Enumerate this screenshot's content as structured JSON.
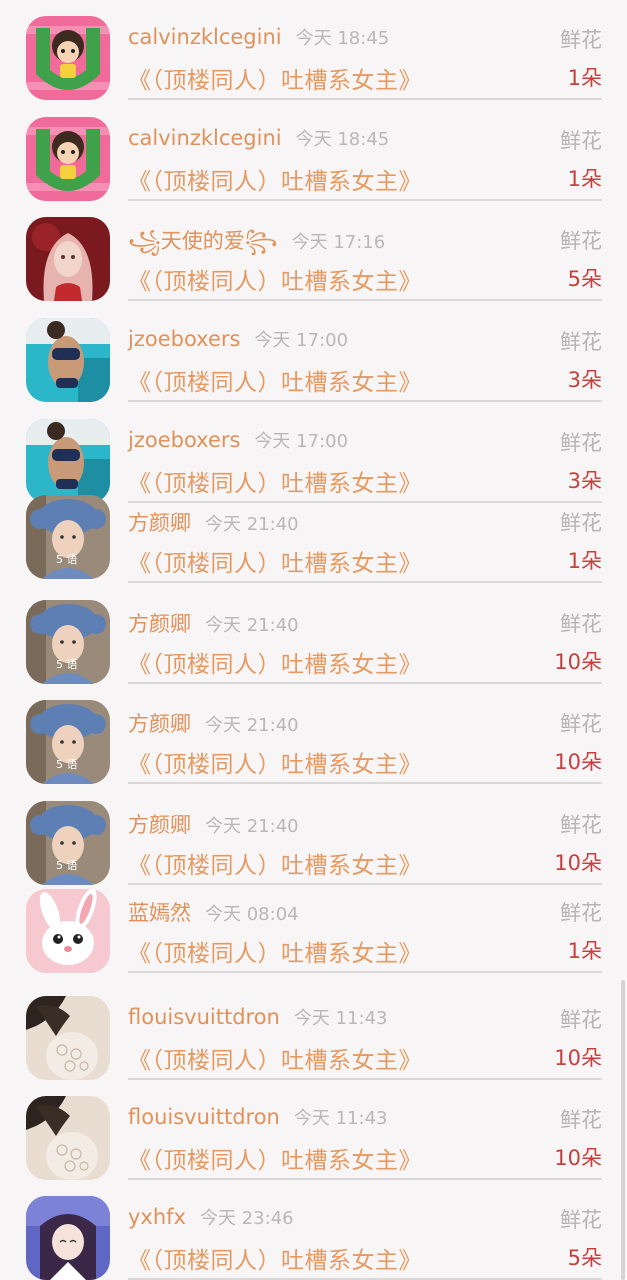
{
  "rows": [
    {
      "name": "calvinzklcegini",
      "time": "今天 18:45",
      "gift": "鲜花",
      "title": "《（顶楼同人）吐槽系女主》",
      "count": "1朵",
      "avatar": "cartoon-girl-avatar"
    },
    {
      "name": "calvinzklcegini",
      "time": "今天 18:45",
      "gift": "鲜花",
      "title": "《（顶楼同人）吐槽系女主》",
      "count": "1朵",
      "avatar": "cartoon-girl-avatar"
    },
    {
      "name": "꧁天使的爱꧂",
      "time": "今天 17:16",
      "gift": "鲜花",
      "title": "《（顶楼同人）吐槽系女主》",
      "count": "5朵",
      "avatar": "pink-hair-girl-avatar"
    },
    {
      "name": "jzoeboxers",
      "time": "今天 17:00",
      "gift": "鲜花",
      "title": "《（顶楼同人）吐槽系女主》",
      "count": "3朵",
      "avatar": "poolside-avatar"
    },
    {
      "name": "jzoeboxers",
      "time": "今天 17:00",
      "gift": "鲜花",
      "title": "《（顶楼同人）吐槽系女主》",
      "count": "3朵",
      "avatar": "poolside-avatar"
    },
    {
      "name": "方颜卿",
      "time": "今天 21:40",
      "gift": "鲜花",
      "title": "《（顶楼同人）吐槽系女主》",
      "count": "1朵",
      "avatar": "blue-hat-boy-avatar"
    },
    {
      "name": "方颜卿",
      "time": "今天 21:40",
      "gift": "鲜花",
      "title": "《（顶楼同人）吐槽系女主》",
      "count": "10朵",
      "avatar": "blue-hat-boy-avatar"
    },
    {
      "name": "方颜卿",
      "time": "今天 21:40",
      "gift": "鲜花",
      "title": "《（顶楼同人）吐槽系女主》",
      "count": "10朵",
      "avatar": "blue-hat-boy-avatar"
    },
    {
      "name": "方颜卿",
      "time": "今天 21:40",
      "gift": "鲜花",
      "title": "《（顶楼同人）吐槽系女主》",
      "count": "10朵",
      "avatar": "blue-hat-boy-avatar"
    },
    {
      "name": "蓝嫣然",
      "time": "今天 08:04",
      "gift": "鲜花",
      "title": "《（顶楼同人）吐槽系女主》",
      "count": "1朵",
      "avatar": "white-rabbit-avatar"
    },
    {
      "name": "flouisvuittdron",
      "time": "今天 11:43",
      "gift": "鲜花",
      "title": "《（顶楼同人）吐槽系女主》",
      "count": "10朵",
      "avatar": "lace-photo-avatar"
    },
    {
      "name": "flouisvuittdron",
      "time": "今天 11:43",
      "gift": "鲜花",
      "title": "《（顶楼同人）吐槽系女主》",
      "count": "10朵",
      "avatar": "lace-photo-avatar"
    },
    {
      "name": "yxhfx",
      "time": "今天 23:46",
      "gift": "鲜花",
      "title": "《（顶楼同人）吐槽系女主》",
      "count": "5朵",
      "avatar": "anime-girl-avatar"
    }
  ],
  "avatar_badge": "5 语",
  "colors": {
    "name": "#e0925a",
    "title": "#e59a62",
    "count": "#c6413e",
    "muted": "#b5b5b5",
    "background": "#f7f5f6"
  }
}
